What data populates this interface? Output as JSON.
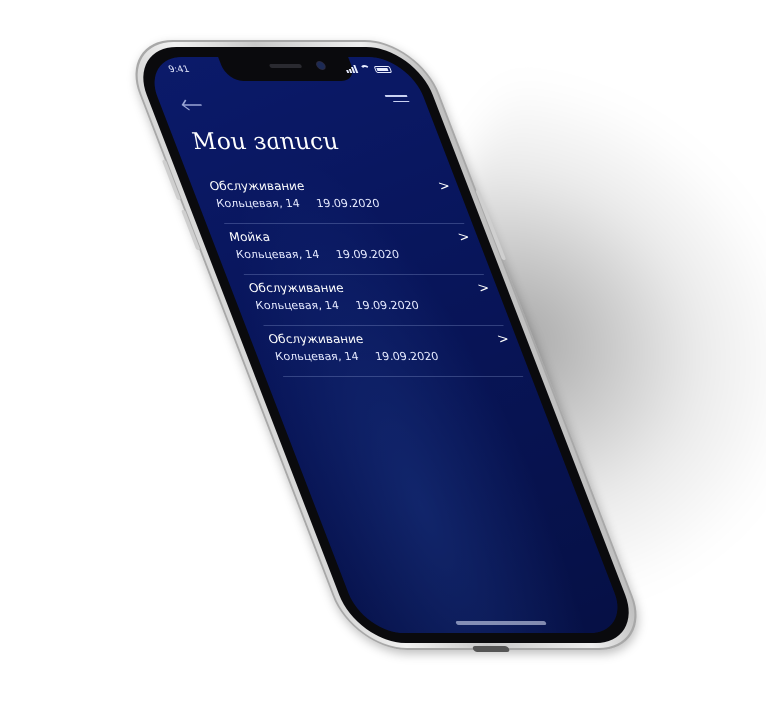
{
  "status_bar": {
    "time": "9:41"
  },
  "navigation": {
    "back_icon": "arrow-left-icon",
    "menu_icon": "menu-icon"
  },
  "page": {
    "title": "Мои записи"
  },
  "records": [
    {
      "title": "Обслуживание",
      "address": "Кольцевая, 14",
      "date": "19.09.2020"
    },
    {
      "title": "Мойка",
      "address": "Кольцевая, 14",
      "date": "19.09.2020"
    },
    {
      "title": "Обслуживание",
      "address": "Кольцевая, 14",
      "date": "19.09.2020"
    },
    {
      "title": "Обслуживание",
      "address": "Кольцевая, 14",
      "date": "19.09.2020"
    }
  ],
  "row_chevron": ">",
  "colors": {
    "screen_background": "#08155a",
    "text": "#ffffff",
    "device_frame": "#e6e6e6"
  }
}
